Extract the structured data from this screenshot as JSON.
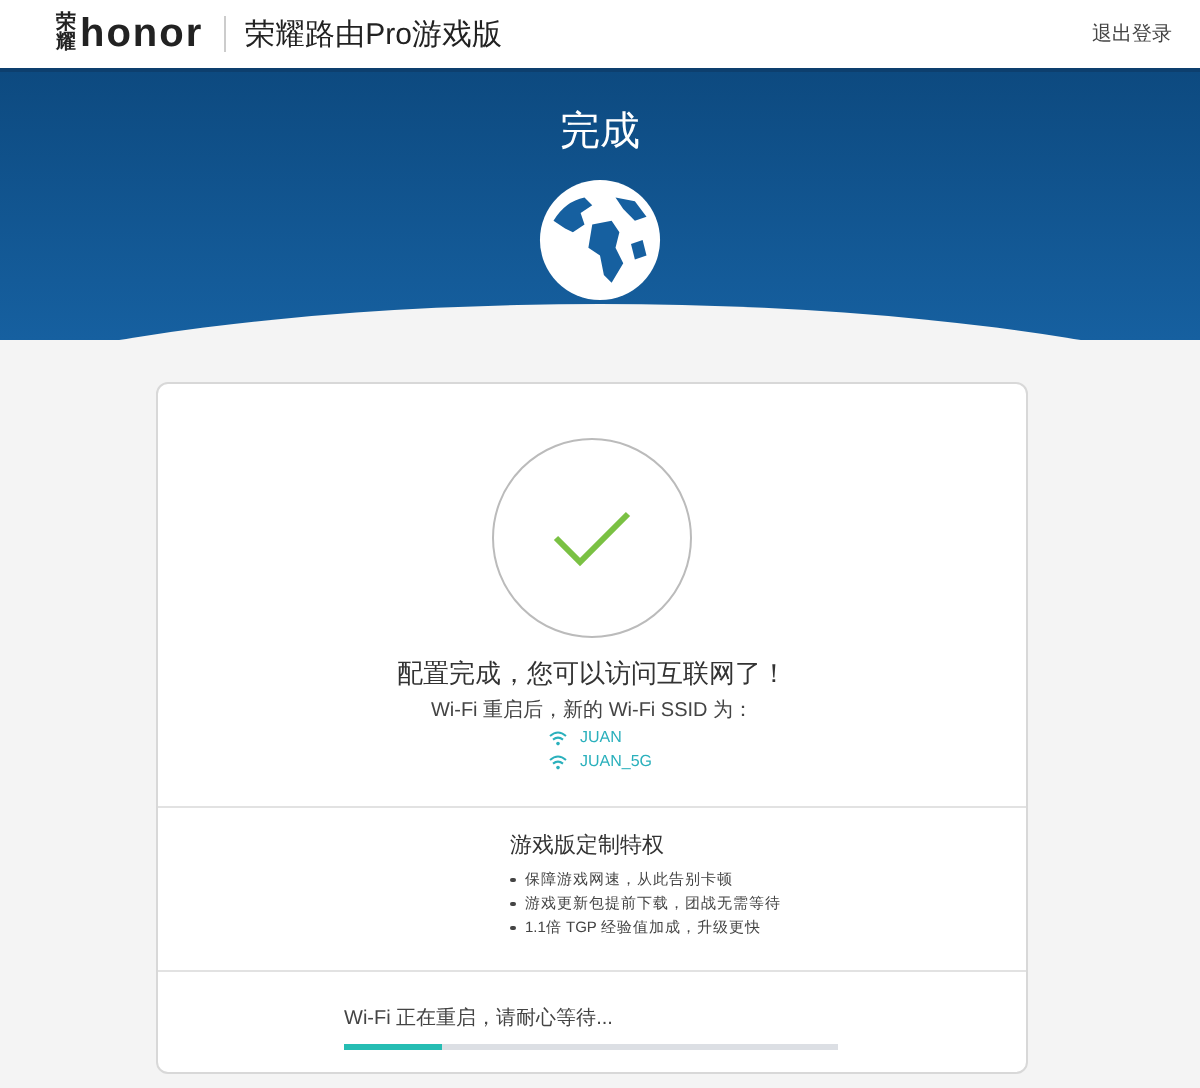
{
  "header": {
    "logo_mark": "荣耀",
    "logo": "honor",
    "title": "荣耀路由Pro游戏版",
    "logout": "退出登录"
  },
  "banner": {
    "title": "完成"
  },
  "result": {
    "message": "配置完成，您可以访问互联网了！",
    "ssid_intro": "Wi-Fi 重启后，新的 Wi-Fi SSID 为：",
    "networks": [
      "JUAN",
      "JUAN_5G"
    ]
  },
  "perks": {
    "title": "游戏版定制特权",
    "items": [
      "保障游戏网速，从此告别卡顿",
      "游戏更新包提前下载，团战无需等待",
      "1.1倍 TGP 经验值加成，升级更快"
    ]
  },
  "status": {
    "text": "Wi-Fi 正在重启，请耐心等待...",
    "level": 0.2
  }
}
